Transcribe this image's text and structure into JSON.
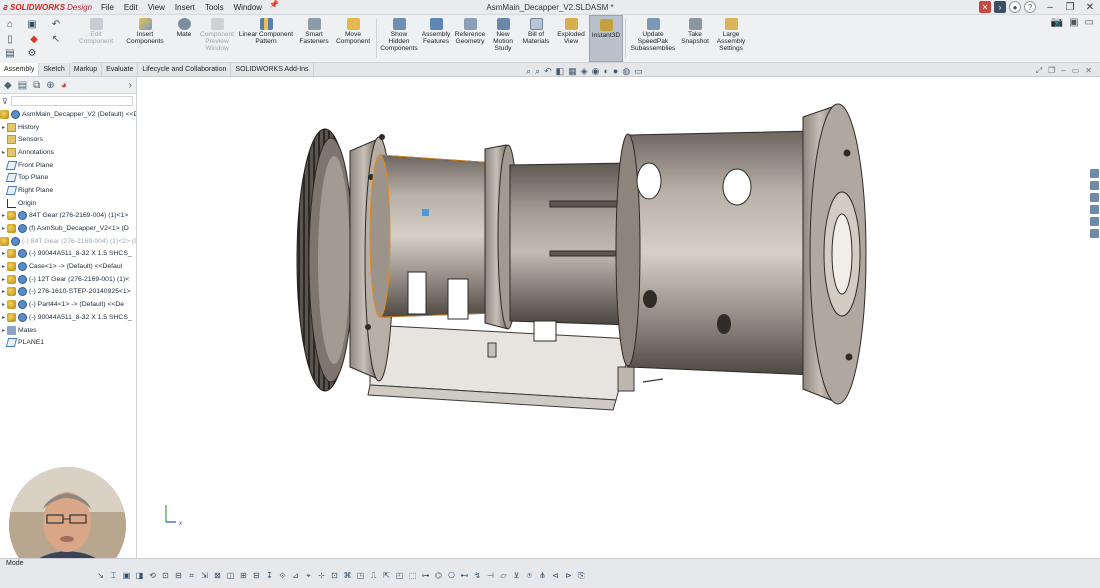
{
  "window": {
    "title": "AsmMain_Decapper_V2.SLDASM *",
    "app_brand": "SOLIDWORKS",
    "app_brand_tail": "Design"
  },
  "menus": [
    "File",
    "Edit",
    "View",
    "Insert",
    "Tools",
    "Window"
  ],
  "command_manager": [
    {
      "label": "Edit\nComponent",
      "enabled": false,
      "icon": "edit-component-icon"
    },
    {
      "label": "Insert\nComponents",
      "enabled": true,
      "icon": "insert-components-icon"
    },
    {
      "label": "Mate",
      "enabled": true,
      "icon": "mate-icon"
    },
    {
      "label": "Component\nPreview\nWindow",
      "enabled": false,
      "icon": "component-preview-icon"
    },
    {
      "label": "Linear Component\nPattern",
      "enabled": true,
      "icon": "linear-pattern-icon"
    },
    {
      "label": "Smart\nFasteners",
      "enabled": true,
      "icon": "smart-fasteners-icon"
    },
    {
      "label": "Move\nComponent",
      "enabled": true,
      "icon": "move-component-icon"
    },
    {
      "label": "Show\nHidden\nComponents",
      "enabled": true,
      "icon": "show-hidden-icon"
    },
    {
      "label": "Assembly\nFeatures",
      "enabled": true,
      "icon": "assembly-features-icon"
    },
    {
      "label": "Reference\nGeometry",
      "enabled": true,
      "icon": "reference-geometry-icon"
    },
    {
      "label": "New\nMotion\nStudy",
      "enabled": true,
      "icon": "motion-study-icon"
    },
    {
      "label": "Bill of\nMaterials",
      "enabled": true,
      "icon": "bom-icon"
    },
    {
      "label": "Exploded\nView",
      "enabled": true,
      "icon": "exploded-view-icon"
    },
    {
      "label": "Instant3D",
      "enabled": true,
      "active": true,
      "icon": "instant3d-icon"
    },
    {
      "label": "Update\nSpeedPak\nSubassemblies",
      "enabled": true,
      "icon": "speedpak-icon"
    },
    {
      "label": "Take\nSnapshot",
      "enabled": true,
      "icon": "snapshot-icon"
    },
    {
      "label": "Large\nAssembly\nSettings",
      "enabled": true,
      "icon": "large-assembly-icon"
    }
  ],
  "tabs": [
    "Assembly",
    "Sketch",
    "Markup",
    "Evaluate",
    "Lifecycle and Collaboration",
    "SOLIDWORKS Add-Ins"
  ],
  "active_tab": "Assembly",
  "feature_tree": {
    "root": "AsmMain_Decapper_V2 (Default) <<D",
    "items": [
      {
        "label": "History",
        "icon": "history-icon",
        "expander": true
      },
      {
        "label": "Sensors",
        "icon": "sensors-icon",
        "expander": false
      },
      {
        "label": "Annotations",
        "icon": "annotations-icon",
        "expander": true
      },
      {
        "label": "Front Plane",
        "icon": "plane-icon",
        "expander": false
      },
      {
        "label": "Top Plane",
        "icon": "plane-icon",
        "expander": false
      },
      {
        "label": "Right Plane",
        "icon": "plane-icon",
        "expander": false
      },
      {
        "label": "Origin",
        "icon": "origin-icon",
        "expander": false
      },
      {
        "label": "84T Gear (276-2169-004) (1)<1>",
        "icon": "part-icon",
        "expander": true
      },
      {
        "label": "(f) AsmSub_Decapper_V2<1> (D",
        "icon": "assembly-icon",
        "expander": true
      },
      {
        "label": "(-) 84T Gear (276-2169-004) (1)<2> (D",
        "icon": "part-icon",
        "expander": false,
        "dim": true
      },
      {
        "label": "(-) 90044A511_8-32 X 1.5 SHCS_",
        "icon": "part-icon",
        "expander": true
      },
      {
        "label": "Case<1> -> (Default) <<Defaul",
        "icon": "part-icon",
        "expander": true
      },
      {
        "label": "(-) 12T Gear (276-2169-001) (1)<",
        "icon": "part-icon",
        "expander": true
      },
      {
        "label": "(-) 276-1610-STEP-20140925<1>",
        "icon": "part-icon",
        "expander": true
      },
      {
        "label": "(-) Part44<1> -> (Default) <<De",
        "icon": "part-icon",
        "expander": true
      },
      {
        "label": "(-) 90044A511_8-32 X 1.5 SHCS_",
        "icon": "part-icon",
        "expander": true
      },
      {
        "label": "Mates",
        "icon": "mates-icon",
        "expander": true
      },
      {
        "label": "PLANE1",
        "icon": "plane-icon",
        "expander": false
      }
    ]
  },
  "status": {
    "label": "Mode"
  },
  "triad": {
    "x_label": "x"
  }
}
